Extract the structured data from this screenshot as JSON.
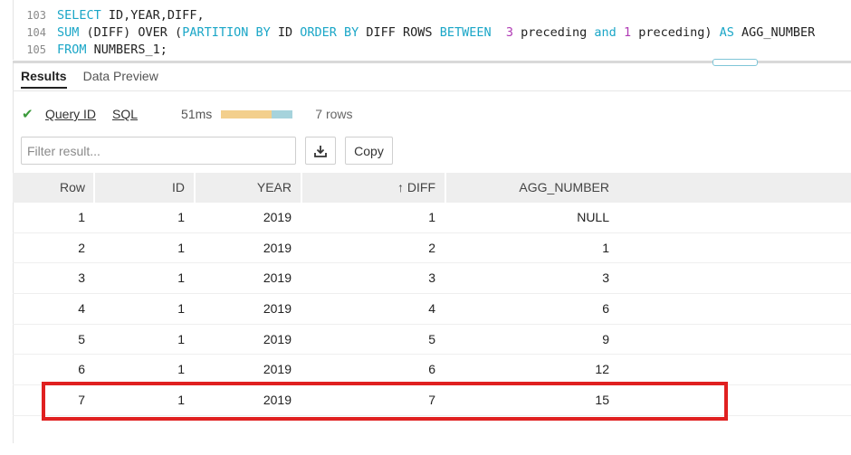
{
  "editor": {
    "lines": [
      {
        "num": "103",
        "parts": [
          {
            "t": "kw",
            "v": "SELECT"
          },
          {
            "t": "txt",
            "v": " ID,YEAR,DIFF,"
          }
        ]
      },
      {
        "num": "104",
        "parts": [
          {
            "t": "kw",
            "v": "SUM"
          },
          {
            "t": "txt",
            "v": " (DIFF) OVER ("
          },
          {
            "t": "kw",
            "v": "PARTITION BY"
          },
          {
            "t": "txt",
            "v": " ID "
          },
          {
            "t": "kw",
            "v": "ORDER BY"
          },
          {
            "t": "txt",
            "v": " DIFF ROWS "
          },
          {
            "t": "kw",
            "v": "BETWEEN"
          },
          {
            "t": "txt",
            "v": "  "
          },
          {
            "t": "num",
            "v": "3"
          },
          {
            "t": "txt",
            "v": " preceding "
          },
          {
            "t": "kw",
            "v": "and"
          },
          {
            "t": "txt",
            "v": " "
          },
          {
            "t": "num",
            "v": "1"
          },
          {
            "t": "txt",
            "v": " preceding) "
          },
          {
            "t": "kw",
            "v": "AS"
          },
          {
            "t": "txt",
            "v": " AGG_NUMBER"
          }
        ]
      },
      {
        "num": "105",
        "parts": [
          {
            "t": "kw",
            "v": "FROM"
          },
          {
            "t": "txt",
            "v": " NUMBERS_1;"
          }
        ]
      }
    ]
  },
  "tabs": {
    "results": "Results",
    "preview": "Data Preview"
  },
  "status": {
    "query_id": "Query ID",
    "sql": "SQL",
    "duration": "51ms",
    "rows": "7 rows",
    "bar_fraction_a": 0.71
  },
  "filter": {
    "placeholder": "Filter result..."
  },
  "toolbar": {
    "copy_label": "Copy",
    "download_icon": "download-icon"
  },
  "table": {
    "headers": {
      "row": "Row",
      "id": "ID",
      "year": "YEAR",
      "diff": "DIFF",
      "agg": "AGG_NUMBER"
    },
    "sort_indicator": "↑",
    "rows": [
      {
        "row": "1",
        "id": "1",
        "year": "2019",
        "diff": "1",
        "agg": "NULL"
      },
      {
        "row": "2",
        "id": "1",
        "year": "2019",
        "diff": "2",
        "agg": "1"
      },
      {
        "row": "3",
        "id": "1",
        "year": "2019",
        "diff": "3",
        "agg": "3"
      },
      {
        "row": "4",
        "id": "1",
        "year": "2019",
        "diff": "4",
        "agg": "6"
      },
      {
        "row": "5",
        "id": "1",
        "year": "2019",
        "diff": "5",
        "agg": "9"
      },
      {
        "row": "6",
        "id": "1",
        "year": "2019",
        "diff": "6",
        "agg": "12"
      },
      {
        "row": "7",
        "id": "1",
        "year": "2019",
        "diff": "7",
        "agg": "15"
      }
    ]
  },
  "colors": {
    "accent": "#1aa6c7",
    "highlight": "#e02020",
    "check": "#3b9a3b"
  }
}
